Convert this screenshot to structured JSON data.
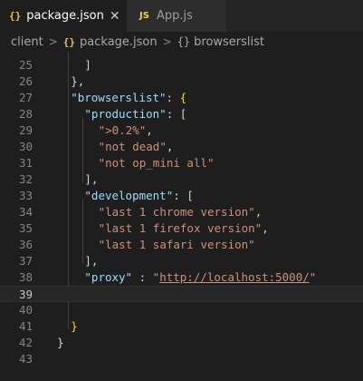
{
  "tabs": [
    {
      "icon": "{}",
      "label": "package.json",
      "active": true
    },
    {
      "icon": "JS",
      "label": "App.js",
      "active": false
    }
  ],
  "breadcrumb": {
    "folder": "client",
    "file_icon": "{}",
    "file": "package.json",
    "symbol_icon": "{}",
    "symbol": "browserslist"
  },
  "editor": {
    "current_line": 39,
    "lines": [
      {
        "n": "25",
        "indent": 4,
        "tokens": [
          {
            "t": "]",
            "c": "p"
          }
        ]
      },
      {
        "n": "26",
        "indent": 2,
        "tokens": [
          {
            "t": "},",
            "c": "p"
          }
        ]
      },
      {
        "n": "27",
        "indent": 2,
        "tokens": [
          {
            "t": "\"browserslist\"",
            "c": "k"
          },
          {
            "t": ": ",
            "c": "p"
          },
          {
            "t": "{",
            "c": "b"
          }
        ]
      },
      {
        "n": "28",
        "indent": 4,
        "tokens": [
          {
            "t": "\"production\"",
            "c": "k"
          },
          {
            "t": ": [",
            "c": "p"
          }
        ]
      },
      {
        "n": "29",
        "indent": 6,
        "tokens": [
          {
            "t": "\">0.2%\"",
            "c": "s"
          },
          {
            "t": ",",
            "c": "p"
          }
        ]
      },
      {
        "n": "30",
        "indent": 6,
        "tokens": [
          {
            "t": "\"not dead\"",
            "c": "s"
          },
          {
            "t": ",",
            "c": "p"
          }
        ]
      },
      {
        "n": "31",
        "indent": 6,
        "tokens": [
          {
            "t": "\"not op_mini all\"",
            "c": "s"
          }
        ]
      },
      {
        "n": "32",
        "indent": 4,
        "tokens": [
          {
            "t": "],",
            "c": "p"
          }
        ]
      },
      {
        "n": "33",
        "indent": 4,
        "tokens": [
          {
            "t": "\"development\"",
            "c": "k"
          },
          {
            "t": ": [",
            "c": "p"
          }
        ]
      },
      {
        "n": "34",
        "indent": 6,
        "tokens": [
          {
            "t": "\"last 1 chrome version\"",
            "c": "s"
          },
          {
            "t": ",",
            "c": "p"
          }
        ]
      },
      {
        "n": "35",
        "indent": 6,
        "tokens": [
          {
            "t": "\"last 1 firefox version\"",
            "c": "s"
          },
          {
            "t": ",",
            "c": "p"
          }
        ]
      },
      {
        "n": "36",
        "indent": 6,
        "tokens": [
          {
            "t": "\"last 1 safari version\"",
            "c": "s"
          }
        ]
      },
      {
        "n": "37",
        "indent": 4,
        "tokens": [
          {
            "t": "],",
            "c": "p"
          }
        ]
      },
      {
        "n": "38",
        "indent": 4,
        "tokens": [
          {
            "t": "\"proxy\"",
            "c": "k"
          },
          {
            "t": " : ",
            "c": "p"
          },
          {
            "t": "\"",
            "c": "s"
          },
          {
            "t": "http://localhost:5000/",
            "c": "u"
          },
          {
            "t": "\"",
            "c": "s"
          }
        ]
      },
      {
        "n": "39",
        "indent": 0,
        "tokens": []
      },
      {
        "n": "40",
        "indent": 0,
        "tokens": []
      },
      {
        "n": "41",
        "indent": 2,
        "tokens": [
          {
            "t": "}",
            "c": "b"
          }
        ]
      },
      {
        "n": "42",
        "indent": 0,
        "tokens": [
          {
            "t": "}",
            "c": "p"
          }
        ]
      },
      {
        "n": "43",
        "indent": 0,
        "tokens": []
      }
    ]
  },
  "colors": {
    "background": "#1e1e1e",
    "key": "#9cdcfe",
    "string": "#ce9178",
    "bracket": "#ffd700",
    "json_icon": "#e8c24d",
    "js_icon": "#e8d44d"
  }
}
